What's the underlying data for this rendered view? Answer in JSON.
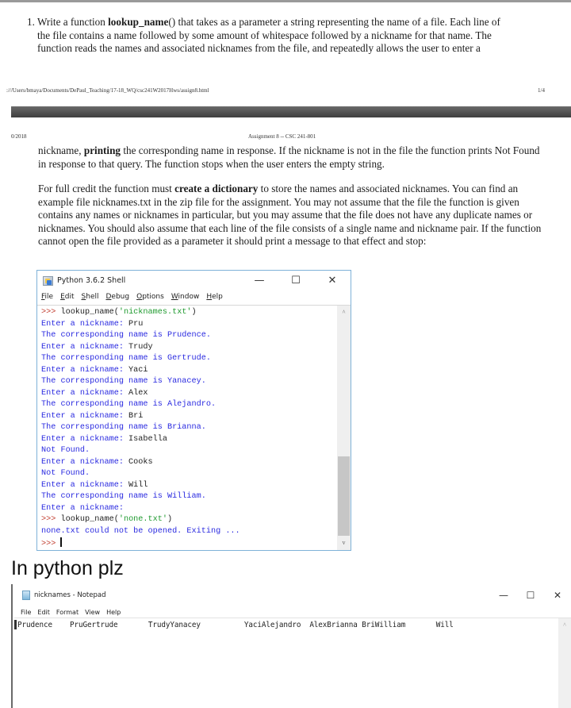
{
  "document": {
    "para1": {
      "number": "1.",
      "lines": [
        {
          "before": " Write a function ",
          "bold": "lookup_name",
          "after": "() that takes as a parameter a string representing the name of a file. Each line of"
        },
        {
          "text": "the file contains a name followed by some amount of whitespace followed by a nickname for that name. The"
        },
        {
          "text": "function reads the names and associated nicknames from the file, and repeatedly allows the user to enter a"
        }
      ]
    },
    "footer": {
      "url": ":///Users/bmaya/Documents/DePaul_Teaching/17-18_WQ/csc241W2017Hws/assign8.html",
      "page": "1/4"
    },
    "header": {
      "date": "0/2018",
      "title": "Assignment 8 -- CSC 241-801"
    },
    "para2": {
      "before": "nickname, ",
      "bold": "printing",
      "after": " the corresponding name in response. If the nickname is not in the file the function prints Not Found in response to that query. The function stops when the user enters the empty string."
    },
    "para3": {
      "before": "For full credit the function must ",
      "bold": "create a dictionary",
      "after": " to store the names and associated nicknames. You can find an example file nicknames.txt in the zip file for the assignment. You may not assume that the file the function is given contains any names or nicknames in particular, but you may assume that the file does not have any duplicate names or nicknames. You should also assume that each line of the file consists of a single name and nickname pair. If the function cannot open the file provided as a parameter it should print a message to that effect and stop:"
    }
  },
  "shell_window": {
    "title": "Python 3.6.2 Shell",
    "controls": {
      "minimize": "—",
      "maximize": "☐",
      "close": "✕"
    },
    "menu": [
      "File",
      "Edit",
      "Shell",
      "Debug",
      "Options",
      "Window",
      "Help"
    ],
    "lines": [
      {
        "type": "call",
        "prompt": ">>> ",
        "func": "lookup_name(",
        "arg": "'nicknames.txt'",
        "close": ")"
      },
      {
        "type": "input",
        "prompt": "Enter a nickname: ",
        "value": "Pru"
      },
      {
        "type": "output",
        "text": "The corresponding name is Prudence."
      },
      {
        "type": "input",
        "prompt": "Enter a nickname: ",
        "value": "Trudy"
      },
      {
        "type": "output",
        "text": "The corresponding name is Gertrude."
      },
      {
        "type": "input",
        "prompt": "Enter a nickname: ",
        "value": "Yaci"
      },
      {
        "type": "output",
        "text": "The corresponding name is Yanacey."
      },
      {
        "type": "input",
        "prompt": "Enter a nickname: ",
        "value": "Alex"
      },
      {
        "type": "output",
        "text": "The corresponding name is Alejandro."
      },
      {
        "type": "input",
        "prompt": "Enter a nickname: ",
        "value": "Bri"
      },
      {
        "type": "output",
        "text": "The corresponding name is Brianna."
      },
      {
        "type": "input",
        "prompt": "Enter a nickname: ",
        "value": "Isabella"
      },
      {
        "type": "output",
        "text": "Not Found."
      },
      {
        "type": "input",
        "prompt": "Enter a nickname: ",
        "value": "Cooks"
      },
      {
        "type": "output",
        "text": "Not Found."
      },
      {
        "type": "input",
        "prompt": "Enter a nickname: ",
        "value": "Will"
      },
      {
        "type": "output",
        "text": "The corresponding name is William."
      },
      {
        "type": "input",
        "prompt": "Enter a nickname: ",
        "value": ""
      },
      {
        "type": "call",
        "prompt": ">>> ",
        "func": "lookup_name(",
        "arg": "'none.txt'",
        "close": ")"
      },
      {
        "type": "output",
        "text": "none.txt could not be opened. Exiting ..."
      },
      {
        "type": "prompt",
        "prompt": ">>> "
      }
    ],
    "scroll": {
      "up": "^",
      "down": "v"
    }
  },
  "caption": "In python plz",
  "notepad": {
    "title": "nicknames - Notepad",
    "controls": {
      "minimize": "—",
      "maximize": "☐",
      "close": "✕"
    },
    "menu": [
      "File",
      "Edit",
      "Format",
      "View",
      "Help"
    ],
    "content": "Prudence    PruGertrude       TrudyYanacey          YaciAlejandro  AlexBrianna BriWilliam       Will",
    "scroll_up": "^"
  }
}
